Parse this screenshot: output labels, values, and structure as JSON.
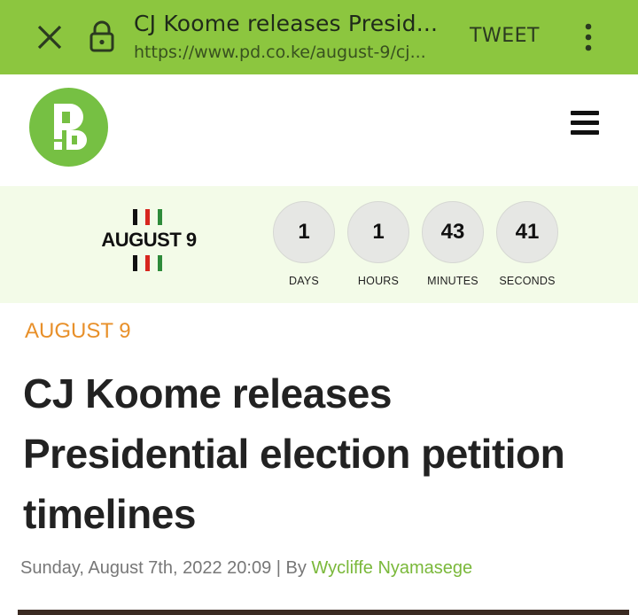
{
  "browser": {
    "page_title": "CJ Koome releases Presid...",
    "url": "https://www.pd.co.ke/august-9/cj...",
    "tweet_label": "TWEET"
  },
  "site": {
    "logo_icon": "pd-logo",
    "menu_icon": "hamburger-menu-icon"
  },
  "countdown": {
    "event_logo_text": "AUGUST 9",
    "units": [
      {
        "value": "1",
        "label": "DAYS"
      },
      {
        "value": "1",
        "label": "HOURS"
      },
      {
        "value": "43",
        "label": "MINUTES"
      },
      {
        "value": "41",
        "label": "SECONDS"
      }
    ]
  },
  "article": {
    "category": "AUGUST 9",
    "headline": "CJ Koome releases Presidential election petition timelines",
    "date": "Sunday, August 7th, 2022 20:09",
    "separator": " | By ",
    "author": "Wycliffe Nyamasege"
  },
  "colors": {
    "topbar": "#8cc63f",
    "brand_green": "#76c043",
    "category_orange": "#e8902a",
    "author_green": "#7ab83a",
    "band_bg": "#f3fbe8"
  }
}
